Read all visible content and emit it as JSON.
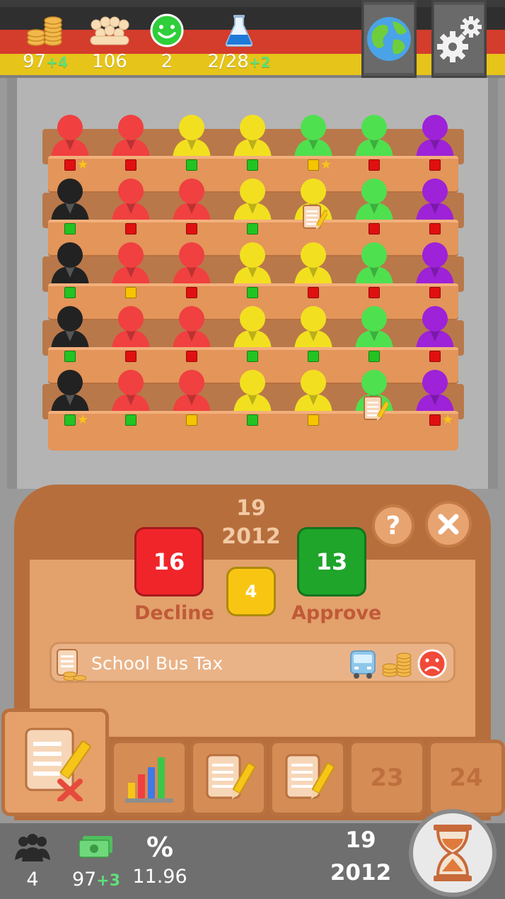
{
  "top_stats": {
    "money": {
      "value": "97",
      "delta": "+4",
      "icon": "coins-icon"
    },
    "population": {
      "value": "106",
      "icon": "crowd-icon"
    },
    "happiness": {
      "value": "2",
      "icon": "smiley-icon"
    },
    "research": {
      "value": "2/28",
      "delta": "+2",
      "icon": "flask-icon"
    }
  },
  "top_buttons": {
    "world": "globe-icon",
    "settings": "gear-icon"
  },
  "parliament": {
    "rows": [
      [
        {
          "color": "#f04040",
          "vote": "#e01010",
          "star": true
        },
        {
          "color": "#f04040",
          "vote": "#e01010",
          "star": false
        },
        {
          "color": "#f2e020",
          "vote": "#22c322",
          "star": false
        },
        {
          "color": "#f2e020",
          "vote": "#22c322",
          "star": false
        },
        {
          "color": "#4fe04f",
          "vote": "#f6c400",
          "star": true
        },
        {
          "color": "#4fe04f",
          "vote": "#e01010",
          "star": false
        },
        {
          "color": "#9d22d8",
          "vote": "#e01010",
          "star": false
        }
      ],
      [
        {
          "color": "#222222",
          "vote": "#22c322",
          "star": false
        },
        {
          "color": "#f04040",
          "vote": "#e01010",
          "star": false
        },
        {
          "color": "#f04040",
          "vote": "#e01010",
          "star": false
        },
        {
          "color": "#f2e020",
          "vote": "#22c322",
          "star": false
        },
        {
          "color": "#f2e020",
          "vote": null,
          "star": false,
          "doc": true
        },
        {
          "color": "#4fe04f",
          "vote": "#e01010",
          "star": false
        },
        {
          "color": "#9d22d8",
          "vote": "#e01010",
          "star": false
        }
      ],
      [
        {
          "color": "#222222",
          "vote": "#22c322",
          "star": false
        },
        {
          "color": "#f04040",
          "vote": "#f6c400",
          "star": false
        },
        {
          "color": "#f04040",
          "vote": "#e01010",
          "star": false
        },
        {
          "color": "#f2e020",
          "vote": "#22c322",
          "star": false
        },
        {
          "color": "#f2e020",
          "vote": "#e01010",
          "star": false
        },
        {
          "color": "#4fe04f",
          "vote": "#e01010",
          "star": false
        },
        {
          "color": "#9d22d8",
          "vote": "#e01010",
          "star": false
        }
      ],
      [
        {
          "color": "#222222",
          "vote": "#22c322",
          "star": false
        },
        {
          "color": "#f04040",
          "vote": "#e01010",
          "star": false
        },
        {
          "color": "#f04040",
          "vote": "#e01010",
          "star": false
        },
        {
          "color": "#f2e020",
          "vote": "#22c322",
          "star": false
        },
        {
          "color": "#f2e020",
          "vote": "#22c322",
          "star": false
        },
        {
          "color": "#4fe04f",
          "vote": "#22c322",
          "star": false
        },
        {
          "color": "#9d22d8",
          "vote": "#e01010",
          "star": false
        }
      ],
      [
        {
          "color": "#222222",
          "vote": "#22c322",
          "star": true
        },
        {
          "color": "#f04040",
          "vote": "#22c322",
          "star": false
        },
        {
          "color": "#f04040",
          "vote": "#f6c400",
          "star": false
        },
        {
          "color": "#f2e020",
          "vote": "#22c322",
          "star": false
        },
        {
          "color": "#f2e020",
          "vote": "#f6c400",
          "star": false
        },
        {
          "color": "#4fe04f",
          "vote": null,
          "star": false,
          "doc": true
        },
        {
          "color": "#9d22d8",
          "vote": "#e01010",
          "star": true
        }
      ]
    ]
  },
  "vote_panel": {
    "date_day": "19",
    "date_year": "2012",
    "decline_count": "16",
    "abstain_count": "4",
    "approve_count": "13",
    "decline_label": "Decline",
    "approve_label": "Approve",
    "decline_color": "#f0252a",
    "abstain_color": "#f8c612",
    "approve_color": "#1ea52a",
    "help_icon": "question-icon",
    "close_icon": "close-icon",
    "law_name": "School Bus Tax",
    "law_icons": [
      "bus-icon",
      "coins-icon",
      "sad-face-icon"
    ]
  },
  "tabs": [
    {
      "type": "law-rejected",
      "icon": "document-pencil-x-icon"
    },
    {
      "type": "stats",
      "icon": "bar-chart-icon"
    },
    {
      "type": "law",
      "icon": "document-pencil-icon"
    },
    {
      "type": "law",
      "icon": "document-pencil-icon"
    },
    {
      "type": "day",
      "label": "23"
    },
    {
      "type": "day",
      "label": "24"
    }
  ],
  "bottom_stats": {
    "voters": {
      "value": "4",
      "icon": "people-icon"
    },
    "budget": {
      "value": "97",
      "delta": "+3",
      "icon": "cash-icon"
    },
    "tax_rate": {
      "value": "11.96",
      "icon": "percent-icon"
    },
    "date_day": "19",
    "date_year": "2012",
    "end_turn_icon": "hourglass-icon"
  }
}
